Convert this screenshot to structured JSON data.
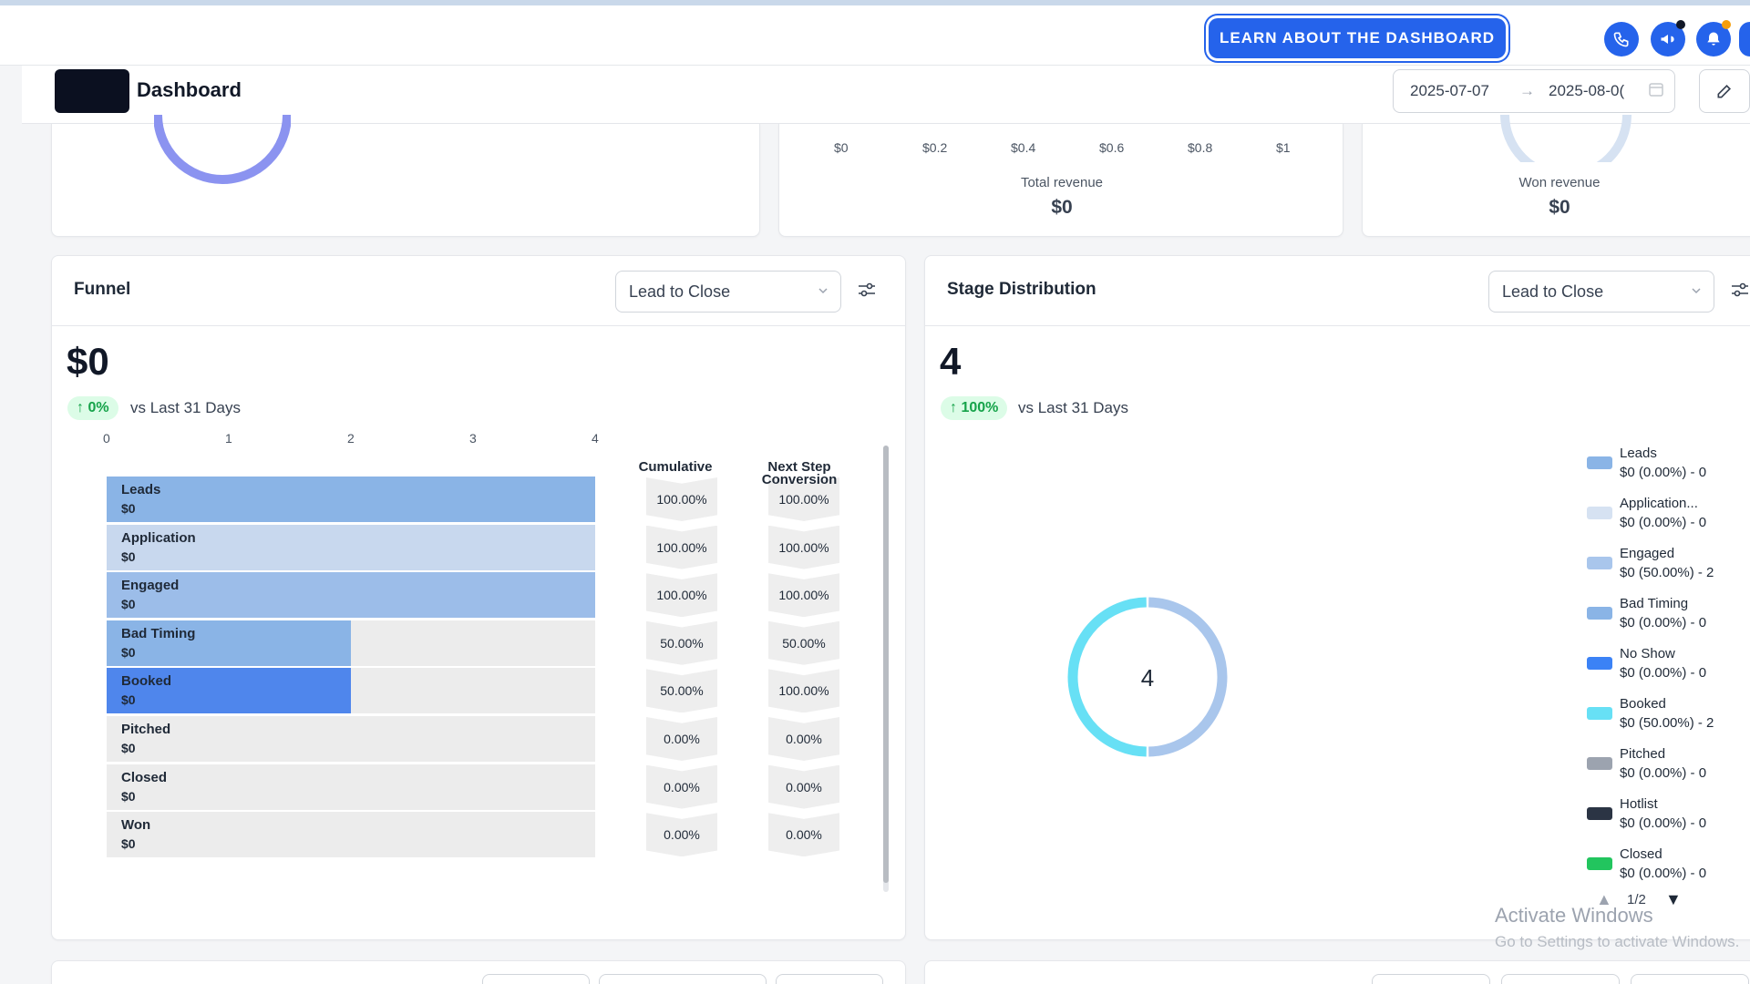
{
  "topbar": {
    "learn_button": "LEARN ABOUT THE DASHBOARD",
    "icons": [
      "phone-icon",
      "megaphone-icon",
      "bell-icon"
    ],
    "accent": "#2563eb"
  },
  "header": {
    "title": "Dashboard",
    "date_start": "2025-07-07",
    "date_end": "2025-08-0("
  },
  "top_cards": {
    "revenue_ticks": [
      "$0",
      "$0.2",
      "$0.4",
      "$0.6",
      "$0.8",
      "$1"
    ],
    "total_revenue_label": "Total revenue",
    "total_revenue_value": "$0",
    "won_revenue_label": "Won revenue",
    "won_revenue_value": "$0"
  },
  "funnel": {
    "title": "Funnel",
    "select_value": "Lead to Close",
    "big_value": "$0",
    "change": "0%",
    "vs_text": "vs Last 31 Days",
    "axis_ticks": [
      "0",
      "1",
      "2",
      "3",
      "4"
    ],
    "cumulative_header": "Cumulative",
    "next_step_header_1": "Next Step",
    "next_step_header_2": "Conversion",
    "stages": [
      {
        "name": "Leads",
        "value": "$0",
        "count": 4,
        "color": "#8ab4e6",
        "cumulative": "100.00%",
        "next": "100.00%"
      },
      {
        "name": "Application",
        "value": "$0",
        "count": 4,
        "color": "#c8d8ee",
        "cumulative": "100.00%",
        "next": "100.00%"
      },
      {
        "name": "Engaged",
        "value": "$0",
        "count": 4,
        "color": "#9cbde9",
        "cumulative": "100.00%",
        "next": "100.00%"
      },
      {
        "name": "Bad Timing",
        "value": "$0",
        "count": 2,
        "color": "#8ab4e6",
        "cumulative": "50.00%",
        "next": "50.00%"
      },
      {
        "name": "Booked",
        "value": "$0",
        "count": 2,
        "color": "#4f86ec",
        "cumulative": "50.00%",
        "next": "100.00%"
      },
      {
        "name": "Pitched",
        "value": "$0",
        "count": 0,
        "color": "#9ca3af",
        "cumulative": "0.00%",
        "next": "0.00%"
      },
      {
        "name": "Closed",
        "value": "$0",
        "count": 0,
        "color": "#22c55e",
        "cumulative": "0.00%",
        "next": "0.00%"
      },
      {
        "name": "Won",
        "value": "$0",
        "count": 0,
        "color": "#16a34a",
        "cumulative": "0.00%",
        "next": "0.00%"
      }
    ],
    "axis_max": 4
  },
  "stage_distribution": {
    "title": "Stage Distribution",
    "select_value": "Lead to Close",
    "big_value": "4",
    "change": "100%",
    "vs_text": "vs Last 31 Days",
    "donut_center": "4",
    "legend_page": "1/2",
    "legend": [
      {
        "name": "Leads",
        "value": "$0 (0.00%) - 0",
        "color": "#8ab4e6"
      },
      {
        "name": "Application...",
        "value": "$0 (0.00%) - 0",
        "color": "#d6e2f2"
      },
      {
        "name": "Engaged",
        "value": "$0 (50.00%) - 2",
        "color": "#a9c6ec"
      },
      {
        "name": "Bad Timing",
        "value": "$0 (0.00%) - 0",
        "color": "#8ab4e6"
      },
      {
        "name": "No Show",
        "value": "$0 (0.00%) - 0",
        "color": "#3b82f6"
      },
      {
        "name": "Booked",
        "value": "$0 (50.00%) - 2",
        "color": "#67e0f5"
      },
      {
        "name": "Pitched",
        "value": "$0 (0.00%) - 0",
        "color": "#9ca3af"
      },
      {
        "name": "Hotlist",
        "value": "$0 (0.00%) - 0",
        "color": "#2b3444"
      },
      {
        "name": "Closed",
        "value": "$0 (0.00%) - 0",
        "color": "#22c55e"
      }
    ]
  },
  "chart_data": {
    "type": "pie",
    "categories": [
      "Engaged",
      "Booked"
    ],
    "values": [
      2,
      2
    ],
    "title": "Stage Distribution"
  },
  "watermark": {
    "line1": "Activate Windows",
    "line2": "Go to Settings to activate Windows."
  }
}
